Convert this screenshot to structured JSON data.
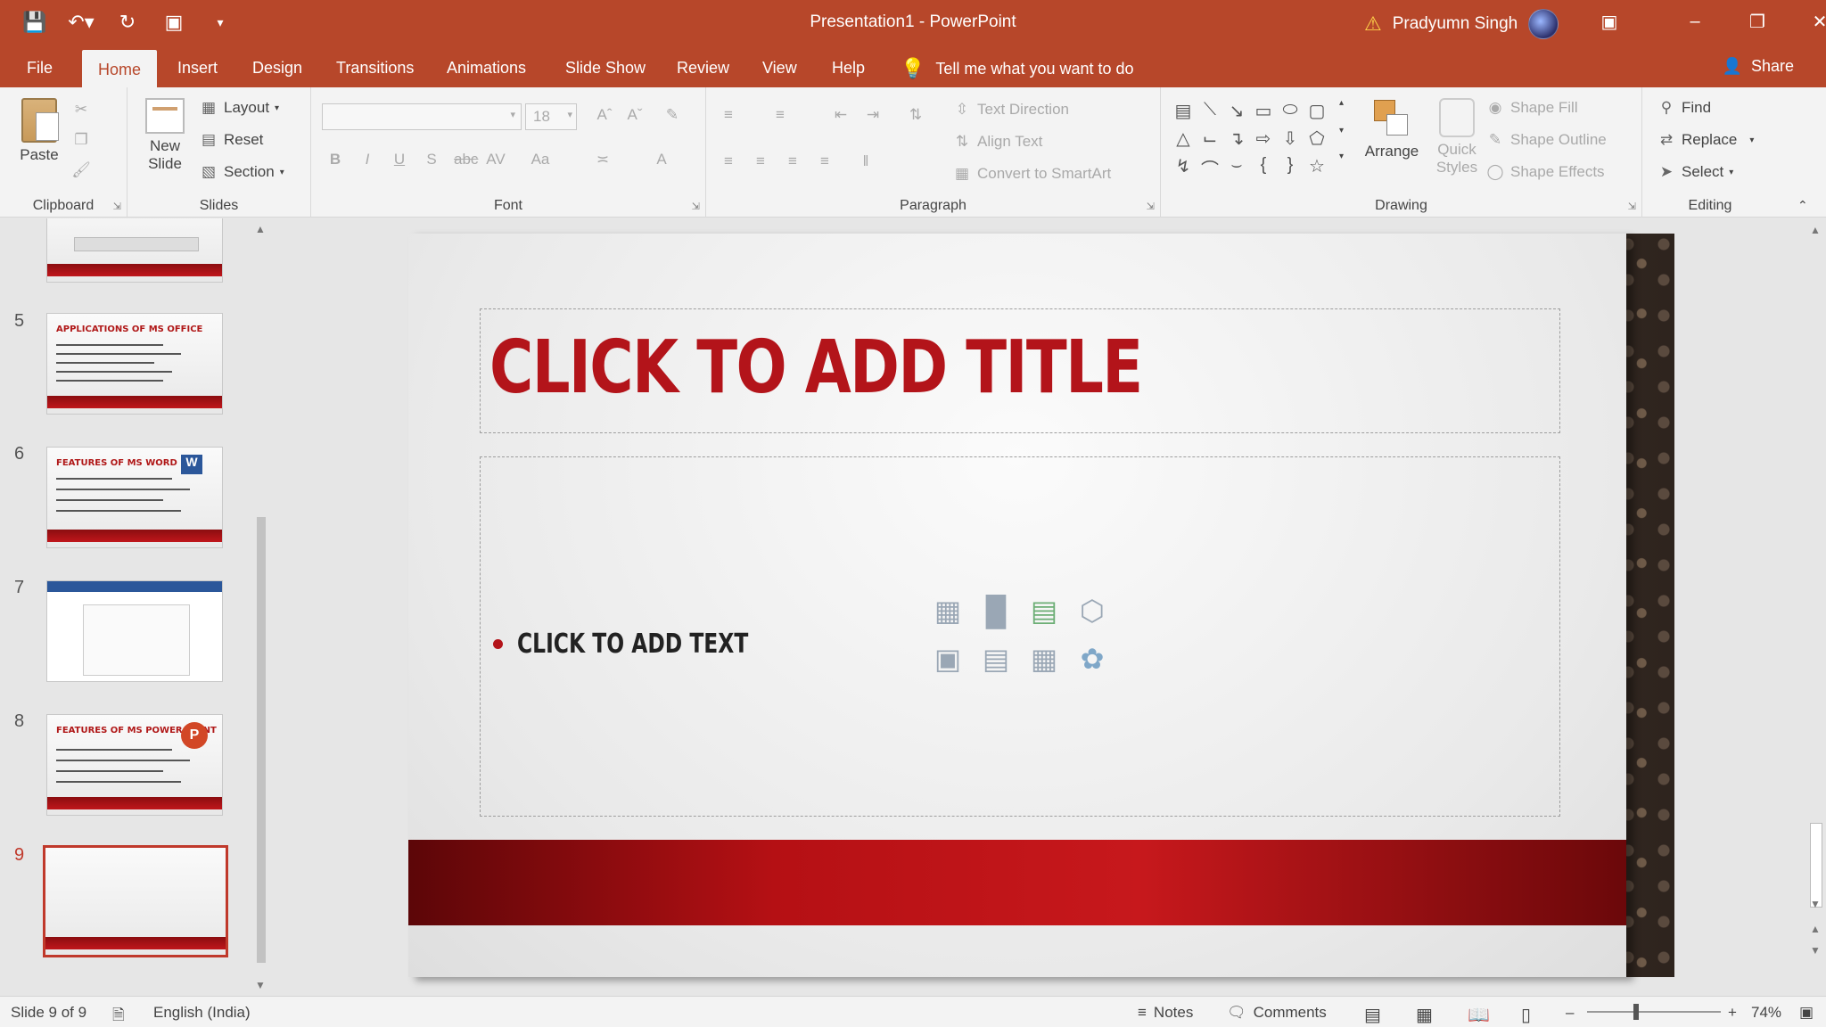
{
  "window": {
    "title": "Presentation1 - PowerPoint",
    "user_name": "Pradyumn Singh"
  },
  "tabs": [
    "File",
    "Home",
    "Insert",
    "Design",
    "Transitions",
    "Animations",
    "Slide Show",
    "Review",
    "View",
    "Help"
  ],
  "active_tab": "Home",
  "tell_me": "Tell me what you want to do",
  "share": "Share",
  "ribbon": {
    "clipboard": {
      "label": "Clipboard",
      "paste": "Paste"
    },
    "slides": {
      "label": "Slides",
      "new_slide_1": "New",
      "new_slide_2": "Slide",
      "layout": "Layout",
      "reset": "Reset",
      "section": "Section"
    },
    "font": {
      "label": "Font",
      "size": "18"
    },
    "paragraph": {
      "label": "Paragraph",
      "text_direction": "Text Direction",
      "align_text": "Align Text",
      "convert_smartart": "Convert to SmartArt"
    },
    "drawing": {
      "label": "Drawing",
      "arrange": "Arrange",
      "quick_styles_1": "Quick",
      "quick_styles_2": "Styles",
      "shape_fill": "Shape Fill",
      "shape_outline": "Shape Outline",
      "shape_effects": "Shape Effects"
    },
    "editing": {
      "label": "Editing",
      "find": "Find",
      "replace": "Replace",
      "select": "Select"
    }
  },
  "thumbnails": [
    {
      "number": "5",
      "title": "APPLICATIONS OF MS OFFICE"
    },
    {
      "number": "6",
      "title": "FEATURES OF MS WORD"
    },
    {
      "number": "7",
      "title": ""
    },
    {
      "number": "8",
      "title": "FEATURES OF MS POWER POINT"
    },
    {
      "number": "9",
      "title": ""
    }
  ],
  "slide": {
    "title_placeholder": "CLICK TO ADD TITLE",
    "body_placeholder": "CLICK TO ADD TEXT"
  },
  "status": {
    "slide_info": "Slide 9 of 9",
    "language": "English (India)",
    "notes": "Notes",
    "comments": "Comments",
    "zoom": "74%",
    "zoom_level": 0.74
  },
  "colors": {
    "accent": "#b7472a",
    "slide_red": "#b3141a"
  }
}
